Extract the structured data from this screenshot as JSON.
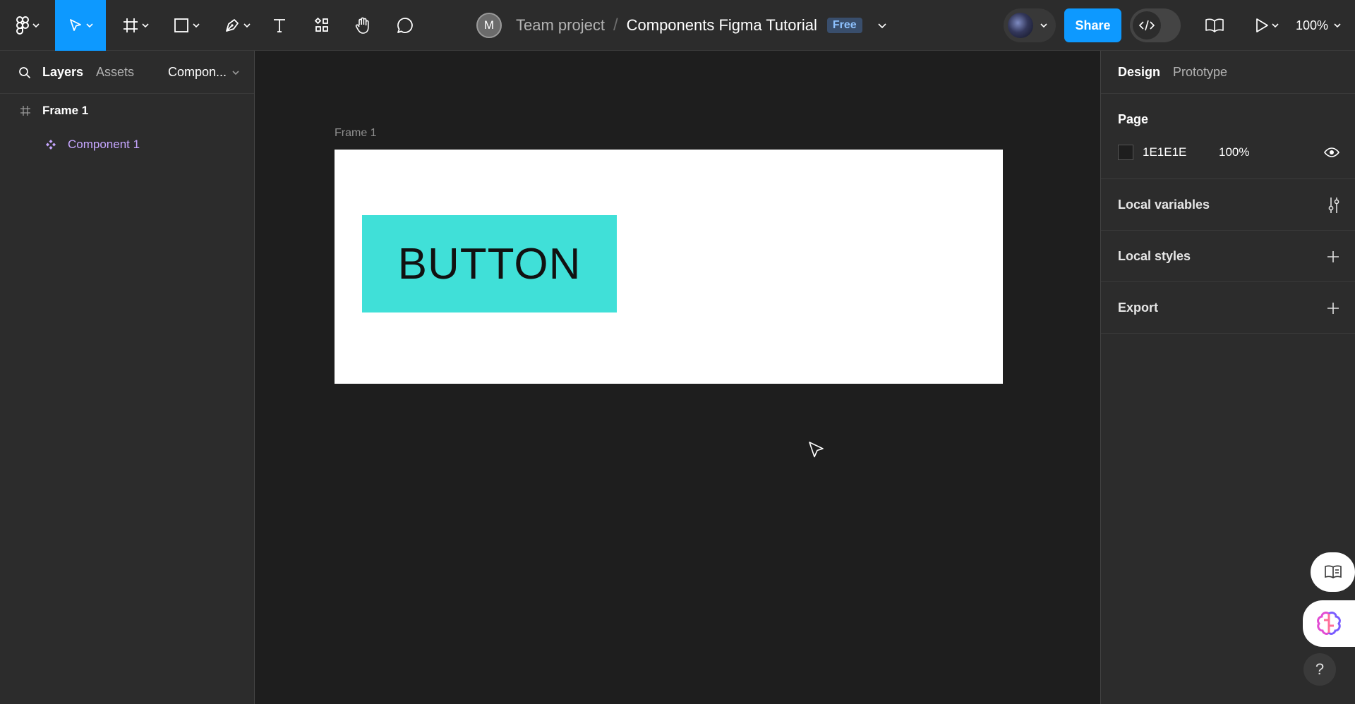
{
  "toolbar": {
    "project": "Team project",
    "separator": "/",
    "file_name": "Components Figma Tutorial",
    "plan_badge": "Free",
    "avatar_initial": "M",
    "share_label": "Share",
    "zoom": "100%"
  },
  "left_panel": {
    "tabs": {
      "layers": "Layers",
      "assets": "Assets",
      "page": "Compon..."
    },
    "layers": [
      {
        "name": "Frame 1",
        "kind": "frame"
      },
      {
        "name": "Component 1",
        "kind": "component"
      }
    ]
  },
  "canvas": {
    "frame_label": "Frame 1",
    "button_text": "BUTTON",
    "background": "#1e1e1e",
    "component_color": "#40e0d8"
  },
  "right_panel": {
    "tabs": {
      "design": "Design",
      "prototype": "Prototype"
    },
    "page": {
      "title": "Page",
      "color": "1E1E1E",
      "opacity": "100%"
    },
    "local_variables": "Local variables",
    "local_styles": "Local styles",
    "export": "Export"
  },
  "colors": {
    "accent": "#0d99ff",
    "component_label": "#c6a6ff"
  }
}
